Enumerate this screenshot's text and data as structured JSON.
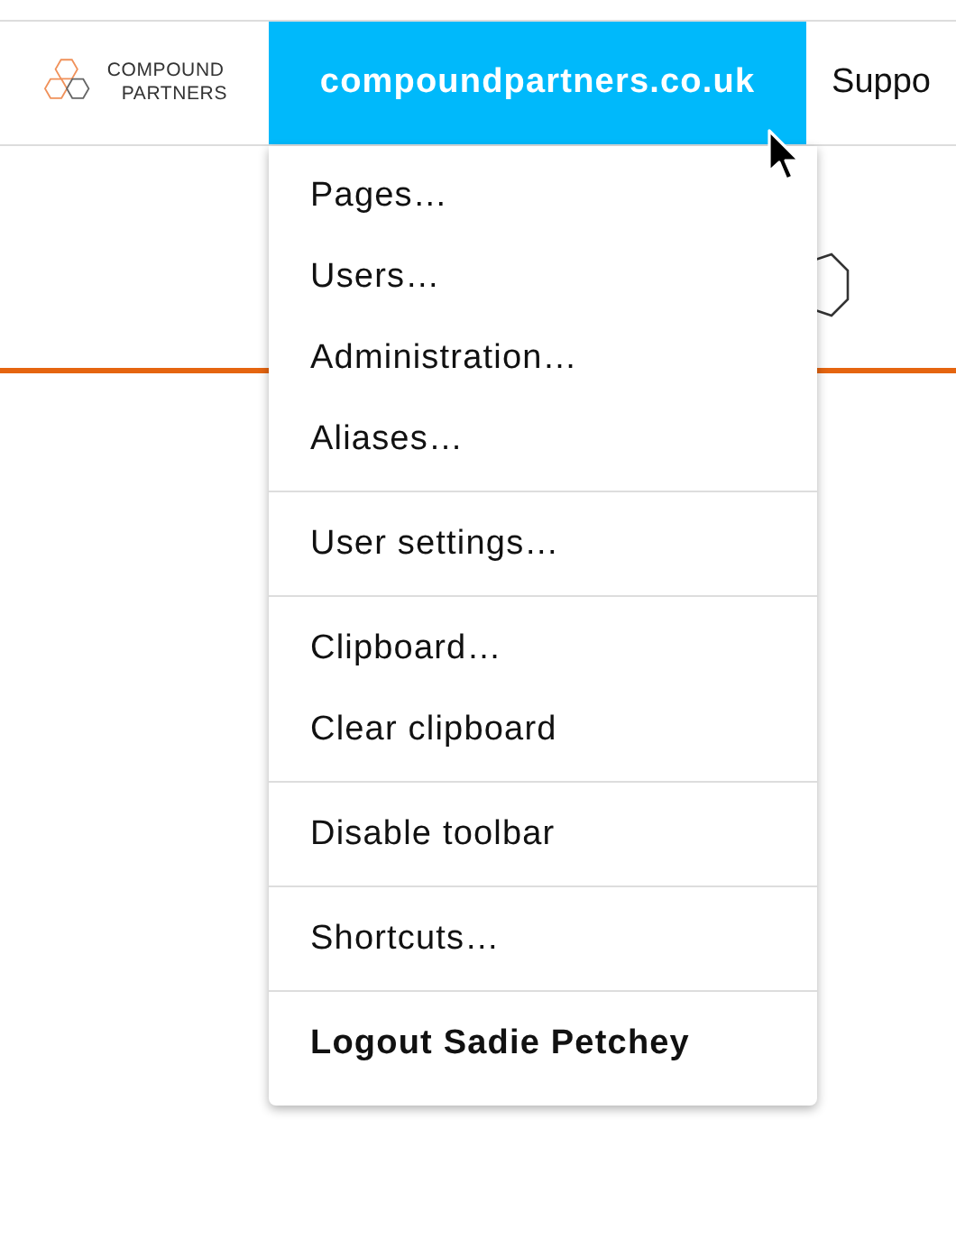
{
  "logo": {
    "lines": [
      "COMPOUND",
      "PARTNERS"
    ]
  },
  "nav_tabs": [
    {
      "label": "compoundpartners.co.uk",
      "selected": true
    },
    {
      "label": "Suppo",
      "selected": false
    }
  ],
  "menu": {
    "sections": [
      {
        "items": [
          {
            "label": "Pages…",
            "kind": "normal"
          },
          {
            "label": "Users…",
            "kind": "normal"
          },
          {
            "label": "Administration…",
            "kind": "normal"
          },
          {
            "label": "Aliases…",
            "kind": "normal"
          }
        ]
      },
      {
        "items": [
          {
            "label": "User settings…",
            "kind": "normal"
          }
        ]
      },
      {
        "items": [
          {
            "label": "Clipboard…",
            "kind": "normal"
          },
          {
            "label": "Clear clipboard",
            "kind": "normal"
          }
        ]
      },
      {
        "items": [
          {
            "label": "Disable toolbar",
            "kind": "normal"
          }
        ]
      },
      {
        "items": [
          {
            "label": "Shortcuts…",
            "kind": "normal"
          }
        ]
      },
      {
        "items": [
          {
            "label": "Logout Sadie Petchey",
            "kind": "strong"
          }
        ]
      }
    ]
  }
}
